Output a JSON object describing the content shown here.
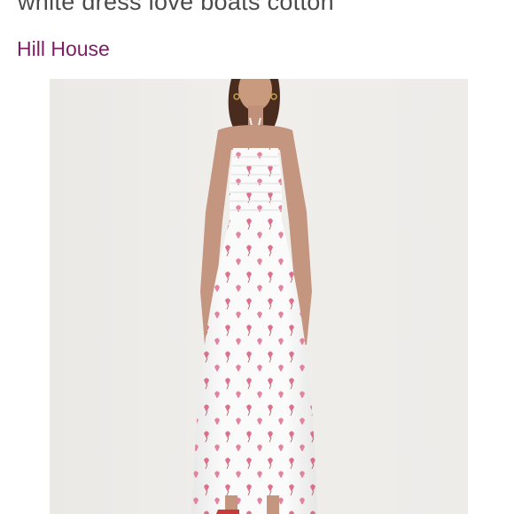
{
  "listing": {
    "title": "white dress love boats cotton",
    "brand": "Hill House"
  },
  "photo": {
    "subject": "model wearing white smocked strapless midi dress with pink boat print",
    "background_color": "#eeece9"
  },
  "colors": {
    "title_text": "#4a4a4a",
    "brand_link": "#7a1f63",
    "dress": "#f7f7f7",
    "print_pink": "#d9587a"
  }
}
